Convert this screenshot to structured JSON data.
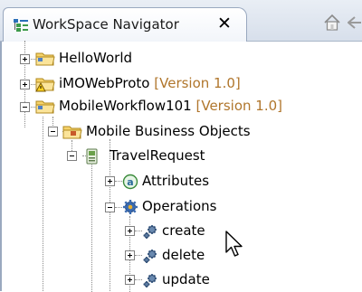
{
  "window": {
    "tab_title": "WorkSpace Navigator",
    "tab_icon": "navigator-icon",
    "close_symbol": "✕"
  },
  "toolbar": {
    "home_icon": "home-icon",
    "back_icon": "back-arrow-icon"
  },
  "tree": {
    "items": [
      {
        "label": "HelloWorld",
        "version": "",
        "icon": "folder-project-icon",
        "expander": "plus"
      },
      {
        "label": "iMOWebProto",
        "version": "[Version 1.0]",
        "icon": "folder-project-warning-icon",
        "expander": "plus"
      },
      {
        "label": "MobileWorkflow101",
        "version": "[Version 1.0]",
        "icon": "folder-project-icon",
        "expander": "minus"
      },
      {
        "label": "Mobile Business Objects",
        "version": "",
        "icon": "folder-mbo-icon",
        "expander": "minus"
      },
      {
        "label": "TravelRequest",
        "version": "",
        "icon": "mbo-icon",
        "expander": "minus"
      },
      {
        "label": "Attributes",
        "version": "",
        "icon": "attributes-icon",
        "expander": "plus"
      },
      {
        "label": "Operations",
        "version": "",
        "icon": "operations-gear-icon",
        "expander": "minus"
      },
      {
        "label": "create",
        "version": "",
        "icon": "operation-gear-icon",
        "expander": "plus"
      },
      {
        "label": "delete",
        "version": "",
        "icon": "operation-gear-icon",
        "expander": "plus"
      },
      {
        "label": "update",
        "version": "",
        "icon": "operation-gear-icon",
        "expander": "plus"
      }
    ]
  },
  "colors": {
    "version_text": "#b0762c",
    "tab_bar": "#d7dfeb",
    "folder": "#f0c040"
  }
}
